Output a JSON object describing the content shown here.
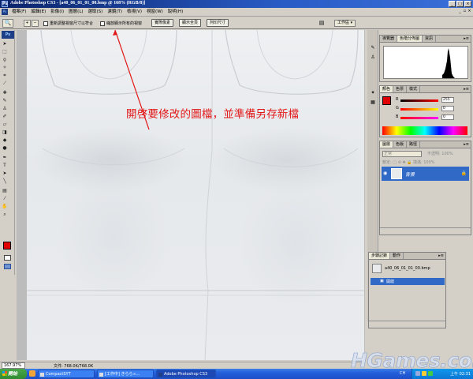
{
  "window": {
    "title": "Adobe Photoshop CS3 - [a40_06_01_01_00.bmp @ 168% (RGB/8)]",
    "app_badge": "Ps"
  },
  "menubar": {
    "items": [
      "檔案(F)",
      "編輯(E)",
      "影像(I)",
      "圖層(L)",
      "選取(S)",
      "濾鏡(T)",
      "檢視(V)",
      "視窗(W)",
      "說明(H)"
    ],
    "workspace_label": "工作區 ▾"
  },
  "options_bar": {
    "zoom_in": "+",
    "zoom_out": "−",
    "resize_windows_label": "重新調整視窗尺寸以符合",
    "zoom_all_label": "縮放顯示所有的視窗",
    "actual_pixels": "實際像素",
    "fit_screen": "顯示全頁",
    "print_size": "列印尺寸",
    "workspace": "工作區 ▾"
  },
  "annotation": {
    "text": "開啓要修改的圖檔，並準備另存新檔",
    "color": "#e21818"
  },
  "statusbar": {
    "zoom": "167.97%",
    "doc_size": "文件: 768.0K/768.0K"
  },
  "histogram_panel": {
    "tabs": [
      "導覽器",
      "色階分佈圖",
      "資訊"
    ],
    "active_tab": 1
  },
  "color_panel": {
    "tabs": [
      "顏色",
      "色票",
      "樣式"
    ],
    "foreground": "#e00000",
    "channels": [
      {
        "label": "R",
        "value": "255"
      },
      {
        "label": "G",
        "value": "0"
      },
      {
        "label": "B",
        "value": "0"
      }
    ]
  },
  "layers_panel": {
    "tabs": [
      "圖層",
      "色版",
      "路徑"
    ],
    "blend_mode": "正常",
    "opacity_label": "不透明: 100%",
    "lock_label": "鎖定: □ ⊘ ✚ 🔒    填滿: 100%",
    "layer_name": "背景"
  },
  "history_panel": {
    "tabs": [
      "步驟記錄",
      "動作"
    ],
    "snapshot_name": "a40_06_01_01_00.bmp",
    "state_name": "開啟"
  },
  "taskbar": {
    "start_label": "開始",
    "tasks": [
      "CompactSYT",
      "[工作中] きらら∞...",
      "Adobe Photoshop CS3"
    ],
    "language": "CH",
    "clock": "上午 02:31"
  },
  "watermark": {
    "text": "HGames.com"
  }
}
